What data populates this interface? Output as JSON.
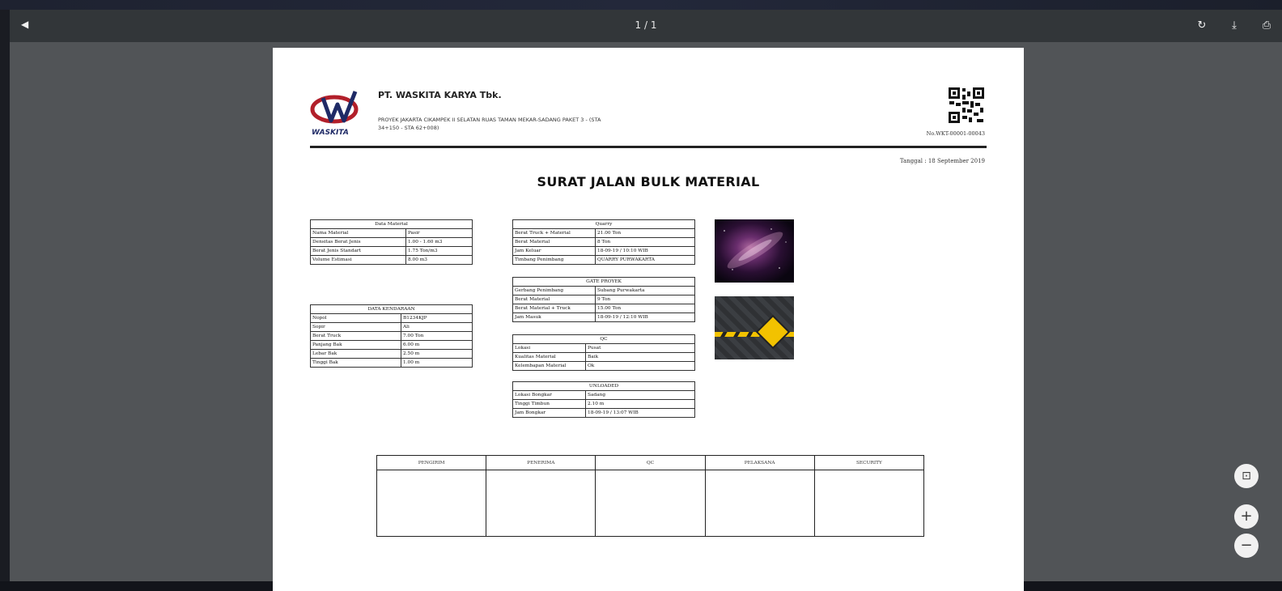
{
  "toolbar": {
    "left_label": "◀",
    "page_indicator": "1 / 1",
    "actions": [
      {
        "name": "rotate-icon",
        "glyph": "↻"
      },
      {
        "name": "download-icon",
        "glyph": "⤓"
      },
      {
        "name": "print-icon",
        "glyph": "⎙"
      }
    ]
  },
  "document": {
    "company": "PT. WASKITA KARYA Tbk.",
    "project_line1": "PROYEK JAKARTA CIKAMPEK II SELATAN RUAS TAMAN MEKAR-SADANG PAKET 3 - (STA",
    "project_line2": "34+150 - STA 62+008)",
    "logo_text": "WASKITA",
    "doc_number": "No.WKT-00001-00043",
    "date": "Tanggal : 18 September 2019",
    "title": "SURAT JALAN BULK MATERIAL",
    "data_material": {
      "header": "Data Material",
      "rows": [
        [
          "Nama Material",
          "Pasir"
        ],
        [
          "Densitas Berat Jenis",
          "1.00 - 1.60 m3"
        ],
        [
          "Berat Jenis Standart",
          "1.75 Ton/m3"
        ],
        [
          "Volume Estimasi",
          "8.00 m3"
        ]
      ]
    },
    "data_kendaraan": {
      "header": "DATA KENDARAAN",
      "rows": [
        [
          "Nopol",
          "B1234KJP"
        ],
        [
          "Sopir",
          "Ali"
        ],
        [
          "Berat Truck",
          "7.00 Ton"
        ],
        [
          "Panjang Bak",
          "6.00 m"
        ],
        [
          "Lebar Bak",
          "2.50 m"
        ],
        [
          "Tinggi Bak",
          "1.00 m"
        ]
      ]
    },
    "quarry": {
      "header": "Quarry",
      "rows": [
        [
          "Berat Truck + Material",
          "21.00 Ton"
        ],
        [
          "Berat Material",
          "8 Ton"
        ],
        [
          "Jam Keluar",
          "18-09-19 / 10:10 WIB"
        ],
        [
          "Timbang Penimbang",
          "QUARRY PURWAKARTA"
        ]
      ]
    },
    "gate_proyek": {
      "header": "GATE PROYEK",
      "rows": [
        [
          "Gerbang Penimbang",
          "Subang Purwakarta"
        ],
        [
          "Berat Material",
          "9 Ton"
        ],
        [
          "Berat Material + Truck",
          "15.00 Ton"
        ],
        [
          "Jam Masuk",
          "18-09-19 / 12:10 WIB"
        ]
      ]
    },
    "qc": {
      "header": "QC",
      "rows": [
        [
          "Lokasi",
          "Pusat"
        ],
        [
          "Kualitas Material",
          "Baik"
        ],
        [
          "Kelembapan Material",
          "Ok"
        ]
      ]
    },
    "unloaded": {
      "header": "UNLOADED",
      "rows": [
        [
          "Lokasi Bongkar",
          "Sadang"
        ],
        [
          "Tinggi Timbun",
          "2.10 m"
        ],
        [
          "Jam Bongkar",
          "18-09-19 / 13:07 WIB"
        ]
      ]
    },
    "signatures": [
      "PENGIRIM",
      "PENERIMA",
      "QC",
      "PELAKSANA",
      "SECURITY"
    ]
  },
  "zoom_controls": [
    {
      "name": "fit-page-button",
      "glyph": "⊡"
    },
    {
      "name": "zoom-in-button",
      "glyph": "+"
    },
    {
      "name": "zoom-out-button",
      "glyph": "−"
    }
  ]
}
